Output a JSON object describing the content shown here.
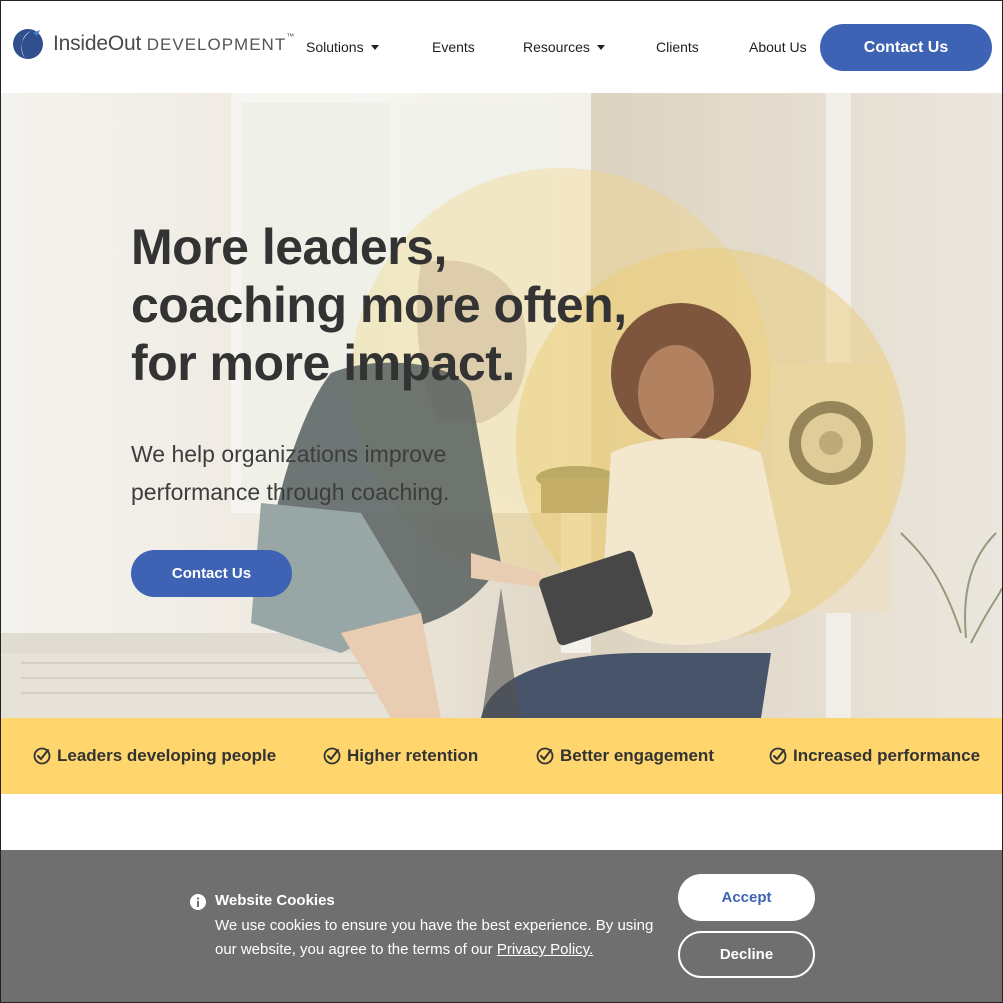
{
  "header": {
    "logo_main": "InsideOut",
    "logo_sub": "DEVELOPMENT",
    "logo_tm": "™",
    "nav": {
      "solutions": "Solutions",
      "events": "Events",
      "resources": "Resources",
      "clients": "Clients",
      "about": "About Us"
    },
    "contact_label": "Contact Us"
  },
  "hero": {
    "headline": [
      "More leaders,",
      "coaching more often,",
      "for more impact."
    ],
    "subline": "We help organizations improve performance through coaching.",
    "cta_label": "Contact Us"
  },
  "benefits": [
    "Leaders developing people",
    "Higher retention",
    "Better engagement",
    "Increased performance"
  ],
  "cookie": {
    "title": "Website Cookies",
    "text": "We use cookies to ensure you have the best experience. By using our website, you agree to the terms of our",
    "link": "Privacy Policy.",
    "accept_label": "Accept",
    "decline_label": "Decline"
  },
  "colors": {
    "brand_blue": "#3f63b4",
    "accent_yellow": "#fed66d",
    "cookie_bg": "#6f6f6f",
    "headline_text": "#333333"
  },
  "icons": {
    "logo": "insideout-leaf-logo",
    "dropdown": "chevron-down-icon",
    "benefit": "check-circle-icon",
    "cookie": "info-icon"
  }
}
